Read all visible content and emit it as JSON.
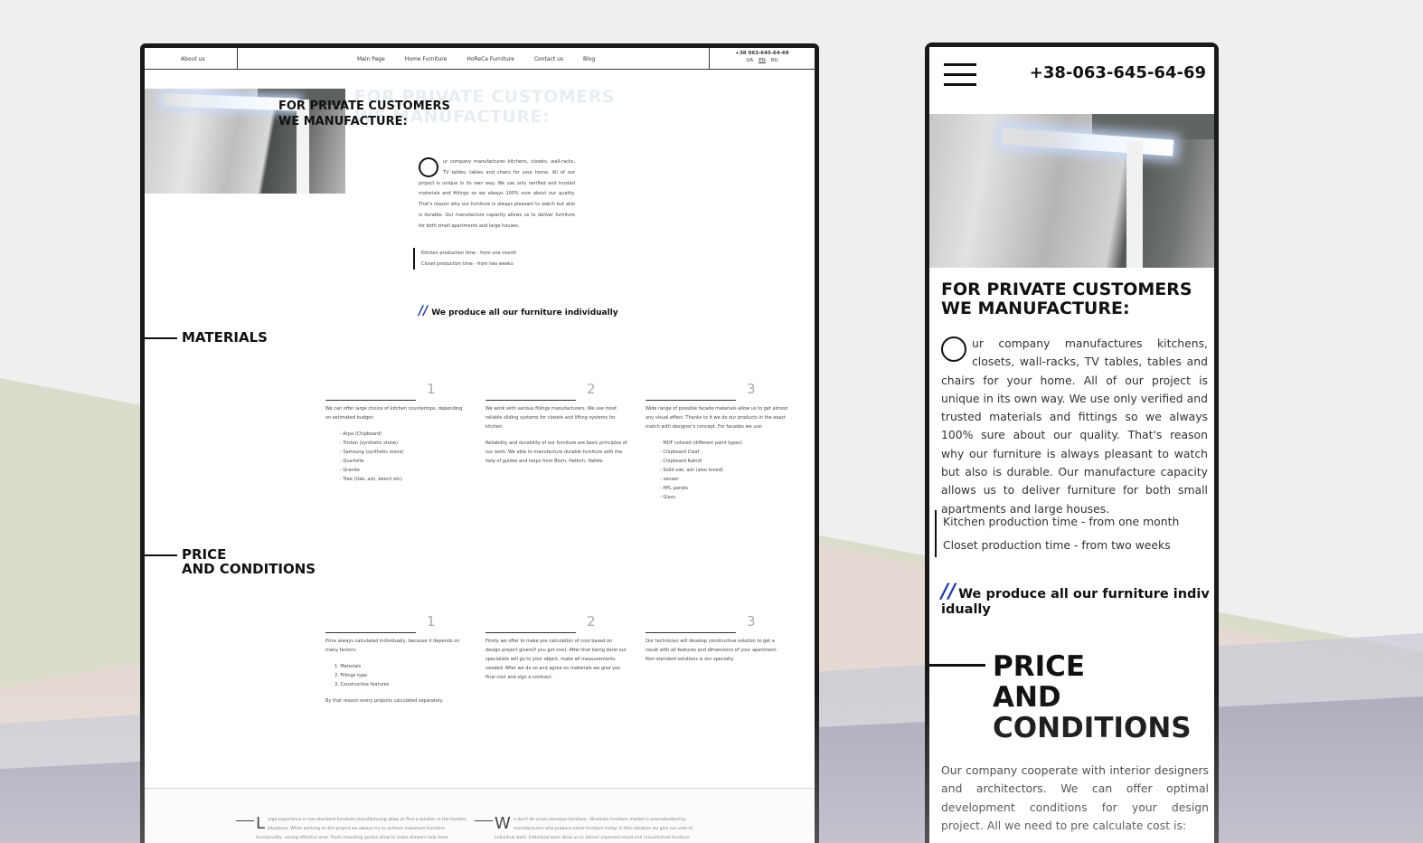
{
  "colors": {
    "accent_slash": "#1f3aa5",
    "frame": "#1a1a1a",
    "page_bg": "#efefef"
  },
  "desktop": {
    "nav": {
      "about": "About us",
      "menu": [
        "Main Page",
        "Home Furniture",
        "HoReCa Furniture",
        "Contact us",
        "Blog"
      ],
      "phone": "+38 063-645-64-69",
      "langs": [
        "UA",
        "EN",
        "RU"
      ],
      "active_lang": "EN"
    },
    "hero": {
      "ghost_title_1": "FOR PRIVATE CUSTOMERS",
      "ghost_title_2": "WE MANUFACTURE:",
      "title_1": "FOR PRIVATE CUSTOMERS",
      "title_2": "WE MANUFACTURE:"
    },
    "intro": "ur company manufactures kitchens, closets, wall-racks, TV tables, tables and chairs for your home. All of our project is unique in its own way. We use only verified and trusted materials and fittings so we always 100% sure about our quality. That's reason why our furniture is always pleasant to watch but also is durable. Our manufacture capacity allows us to deliver furniture for both small apartments and large houses.",
    "times": [
      "Kitchen production time - from one month",
      "Closet production time - from two weeks"
    ],
    "slogan_mark": "//",
    "slogan": "We produce all our furniture individually",
    "materials": {
      "title": "MATERIALS",
      "cols": [
        {
          "num": "1",
          "text": "We can offer large choice of kitchen countertops, depending on estimated budget:",
          "items": [
            "- Arpa (Chipboard)",
            "- Tristan (synthetic stone)",
            "- Samsung (synthetic stone)",
            "- Quartzite",
            "- Granite",
            "- Tree (Oak, ash, beech etc)"
          ]
        },
        {
          "num": "2",
          "text": "We work with various fillings manufacturers. We use most reliable sliding systems for closets and lifting systems for kitchen.",
          "text2": "Reliability and durability of our furniture are basic principles of our work. We able to manufacture durable furniture with the help of guides and loops from Blum, Hettich, Hafele."
        },
        {
          "num": "3",
          "text": "Wide range of possible facade materials allow us to get almost any visual effect. Thanks to it we do our products in the exact match with designer's concept. For facades we use:",
          "items": [
            "- MDF colored (different paint types)",
            "- Chipboard Cleaf",
            "- Chipboard Kaindl",
            "- Solid oak, ash (also toned)",
            "- veneer",
            "- HPL panels",
            "- Glass"
          ]
        }
      ]
    },
    "price": {
      "title_1": "PRICE",
      "title_2": "AND CONDITIONS",
      "cols": [
        {
          "num": "1",
          "text": "Price always calculated individually, because it depends on many factors:",
          "items": [
            "1. Materials",
            "2. Fillings type",
            "3. Constructive features"
          ],
          "note": "By that reason every projects calculated separately."
        },
        {
          "num": "2",
          "text": "Firstly we offer to make pre calculation of cost based on design project given(if you got one). After that being done our specialists will go to your object, make all measurements needed. After we do so and agree on materials we give you final cost and sign a contract."
        },
        {
          "num": "3",
          "text": "Our technician will develop constructive solution to get a result with all features and dimensions of your apartment. Non-standard solutions is our specialty."
        }
      ]
    },
    "footer": {
      "col1_cap": "L",
      "col1": "arge experience in non-standard furniture manufacturing allow us find a solution in the hardest situations. While working on the project we always try to achieve maximum furniture functionality, saving effective area. Flush mounting guides allow to make drawers look more",
      "col2_cap": "W",
      "col2": "e don't do usual conveyor furniture. Ukrainian furniture market is oversaturated by manufacturers who produce serial furniture today. In this situation we give our vote to individual work. Individual work allow us to deliver expected result and manufacture furniture"
    }
  },
  "mobile": {
    "phone": "+38-063-645-64-69",
    "title_1": "FOR PRIVATE CUSTOMERS",
    "title_2": "WE MANUFACTURE:",
    "intro": "ur company manufactures kitchens, closets, wall-racks, TV tables, tables and chairs for your home. All of our project is unique in its own way. We use only verified and trusted materials and fittings so we always 100% sure about our quality. That's reason why our furniture is always pleasant to watch but also is durable. Our manufacture capacity allows us to deliver furniture for both small apartments and large houses.",
    "times": [
      "Kitchen production time - from one month",
      "Closet production time - from two weeks"
    ],
    "slogan_mark": "//",
    "slogan": "We produce all our furniture individually",
    "section_1": "PRICE",
    "section_2": "AND",
    "section_3": "CONDITIONS",
    "text": "Our company cooperate with interior designers and architectors. We can offer optimal development conditions for your design project. All we need to pre calculate cost is:"
  }
}
